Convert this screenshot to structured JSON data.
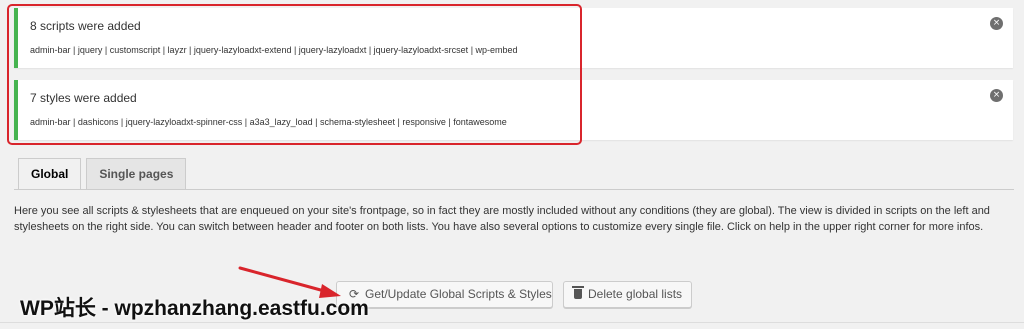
{
  "notices": {
    "scripts": {
      "title": "8 scripts were added",
      "list": "admin-bar | jquery | customscript | layzr | jquery-lazyloadxt-extend | jquery-lazyloadxt | jquery-lazyloadxt-srcset | wp-embed",
      "dismiss_icon": "×"
    },
    "styles": {
      "title": "7 styles were added",
      "list": "admin-bar | dashicons | jquery-lazyloadxt-spinner-css | a3a3_lazy_load | schema-stylesheet | responsive | fontawesome",
      "dismiss_icon": "×"
    },
    "accent_color": "#46b450"
  },
  "tabs": [
    {
      "label": "Global",
      "active": true
    },
    {
      "label": "Single pages",
      "active": false
    }
  ],
  "description": "Here you see all scripts & stylesheets that are enqueued on your site's frontpage, so in fact they are mostly included without any conditions (they are global). The view is divided in scripts on the left and stylesheets on the right side. You can switch between header and footer on both lists. You have also several options to customize every single file. Click on help in the upper right corner for more infos.",
  "buttons": {
    "update": {
      "label": "Get/Update Global Scripts & Styles",
      "icon": "refresh-icon",
      "glyph": "⟳"
    },
    "delete": {
      "label": "Delete global lists",
      "icon": "trash-icon"
    }
  },
  "watermark": "WP站长 - wpzhanzhang.eastfu.com",
  "annotation_color": "#d9252c"
}
